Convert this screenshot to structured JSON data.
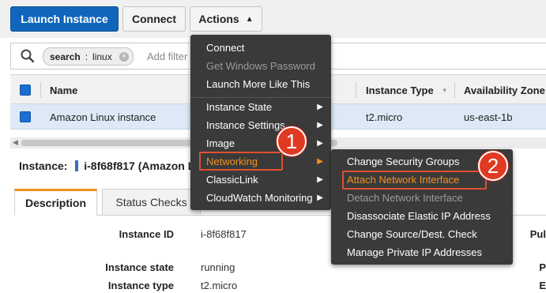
{
  "toolbar": {
    "launch_label": "Launch Instance",
    "connect_label": "Connect",
    "actions_label": "Actions"
  },
  "search": {
    "chip_key": "search",
    "chip_sep": ":",
    "chip_value": "linux",
    "placeholder": "Add filter"
  },
  "table": {
    "headers": [
      "Name",
      "Instance Type",
      "Availability Zone"
    ],
    "row": {
      "name": "Amazon Linux instance",
      "type": "t2.micro",
      "zone": "us-east-1b"
    }
  },
  "instance": {
    "prefix": "Instance:",
    "id_text": "i-8f68f817 (Amazon L"
  },
  "tabs": [
    "Description",
    "Status Checks"
  ],
  "details": [
    {
      "label": "Instance ID",
      "value": "i-8f68f817"
    },
    {
      "label": "Instance state",
      "value": "running"
    },
    {
      "label": "Instance type",
      "value": "t2.micro"
    }
  ],
  "right_edge": [
    "Pul",
    "P",
    "E"
  ],
  "actions_menu": {
    "group1": [
      "Connect",
      "Get Windows Password",
      "Launch More Like This"
    ],
    "group2": [
      "Instance State",
      "Instance Settings",
      "Image",
      "Networking",
      "ClassicLink",
      "CloudWatch Monitoring"
    ]
  },
  "networking_menu": [
    "Change Security Groups",
    "Attach Network Interface",
    "Detach Network Interface",
    "Disassociate Elastic IP Address",
    "Change Source/Dest. Check",
    "Manage Private IP Addresses"
  ],
  "badges": [
    "1",
    "2"
  ],
  "colors": {
    "accent": "#f5901e",
    "primary": "#1166bb",
    "callout": "#e03a22"
  }
}
